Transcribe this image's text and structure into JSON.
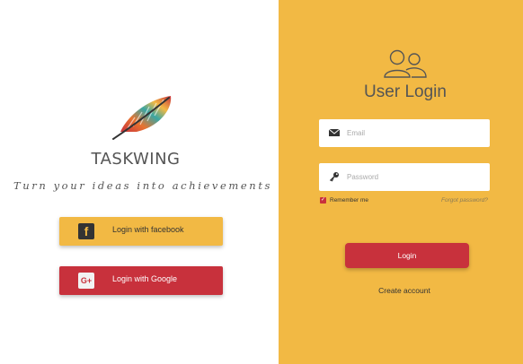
{
  "brand": {
    "name": "TASKWING",
    "tagline": "Turn your ideas into achievements",
    "logo_icon": "feather-icon"
  },
  "social": {
    "facebook": {
      "label": "Login with facebook",
      "icon": "facebook-icon"
    },
    "google": {
      "label": "Login with Google",
      "icon": "google-plus-icon"
    }
  },
  "login": {
    "title": "User Login",
    "header_icon": "users-icon",
    "email": {
      "placeholder": "Email",
      "value": "",
      "icon": "envelope-icon"
    },
    "password": {
      "placeholder": "Password",
      "value": "",
      "icon": "key-icon"
    },
    "remember_me": {
      "label": "Remember me",
      "checked": true
    },
    "forgot_password": "Forgot password?",
    "submit_label": "Login",
    "create_account": "Create account"
  },
  "colors": {
    "accent_yellow": "#f2b944",
    "accent_red": "#c8313c",
    "text_dark": "#333333",
    "text_gray": "#555555"
  }
}
